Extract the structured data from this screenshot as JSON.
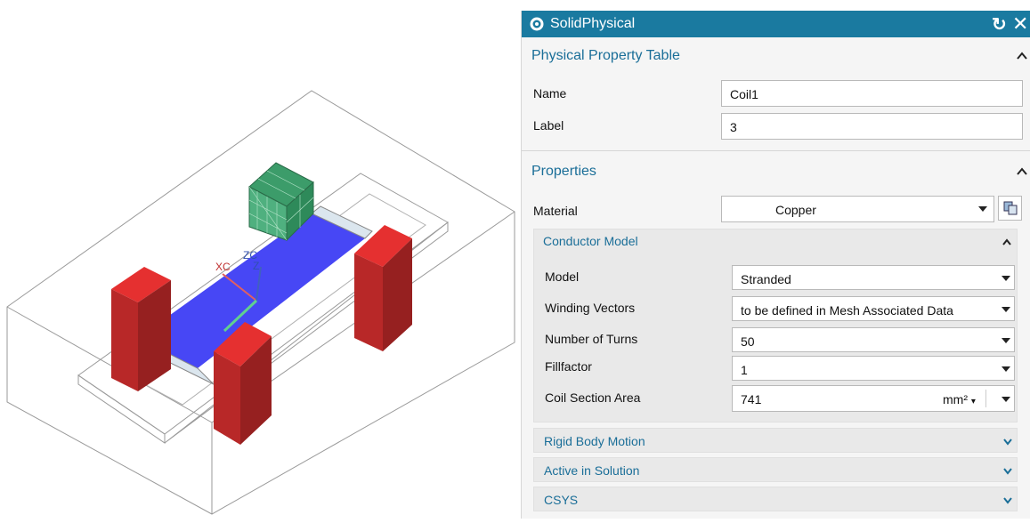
{
  "window": {
    "title": "SolidPhysical"
  },
  "viewport": {
    "triad_labels": [
      "XC",
      "ZC",
      "Z"
    ]
  },
  "sections": {
    "physical": {
      "header": "Physical Property Table",
      "name_label": "Name",
      "name_value": "Coil1",
      "label_label": "Label",
      "label_value": "3"
    },
    "properties": {
      "header": "Properties",
      "material_label": "Material",
      "material_value": "Copper"
    },
    "conductor": {
      "header": "Conductor Model",
      "model_label": "Model",
      "model_value": "Stranded",
      "winding_label": "Winding Vectors",
      "winding_value": "to be defined in Mesh Associated Data",
      "turns_label": "Number of Turns",
      "turns_value": "50",
      "fill_label": "Fillfactor",
      "fill_value": "1",
      "area_label": "Coil Section Area",
      "area_value": "741",
      "area_unit": "mm²"
    },
    "collapsed": [
      "Rigid Body Motion",
      "Active in Solution",
      "CSYS"
    ]
  },
  "colors": {
    "accent": "#1a7aa0",
    "header_text": "#1a6e98",
    "coil_red": "#e53030",
    "plate_blue": "#4a4aff",
    "mesh_green": "#3c9c6a"
  }
}
